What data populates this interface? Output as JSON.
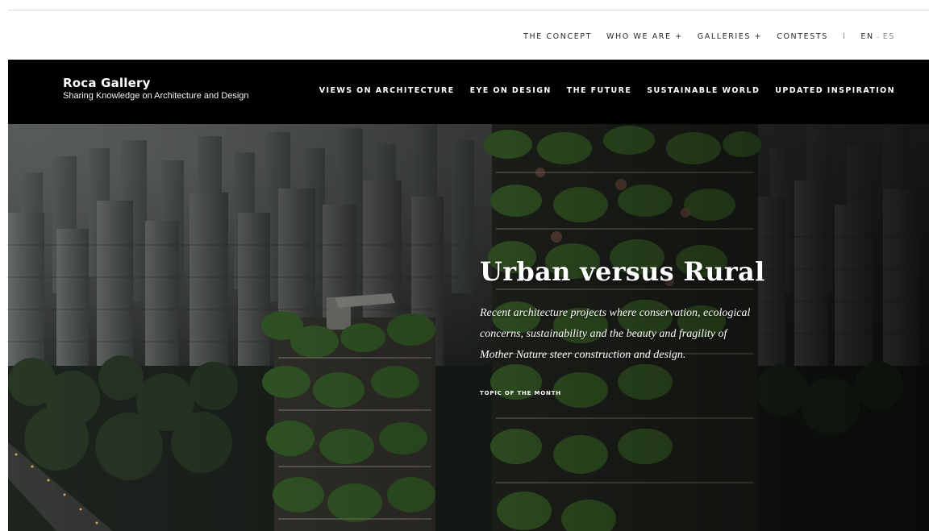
{
  "top_nav": {
    "items": [
      "THE CONCEPT",
      "WHO WE ARE +",
      "GALLERIES +",
      "CONTESTS"
    ],
    "separator": "I",
    "lang_en": "EN",
    "lang_dash": "–",
    "lang_es": "ES"
  },
  "brand": {
    "name": "Roca Gallery",
    "tagline": "Sharing Knowledge on Architecture and Design"
  },
  "main_nav": {
    "items": [
      "VIEWS ON ARCHITECTURE",
      "EYE ON DESIGN",
      "THE FUTURE",
      "SUSTAINABLE WORLD",
      "UPDATED INSPIRATION"
    ]
  },
  "hero": {
    "title": "Urban versus Rural",
    "description": "Recent architecture projects where conservation, ecological concerns, sustainability and the beauty and fragility of Mother Nature steer construction and design.",
    "kicker": "TOPIC OF THE MONTH"
  },
  "colors": {
    "header_bg": "#000000",
    "topbar_bg": "#ffffff",
    "text_light": "#ffffff",
    "text_dark": "#2a2a2a"
  }
}
